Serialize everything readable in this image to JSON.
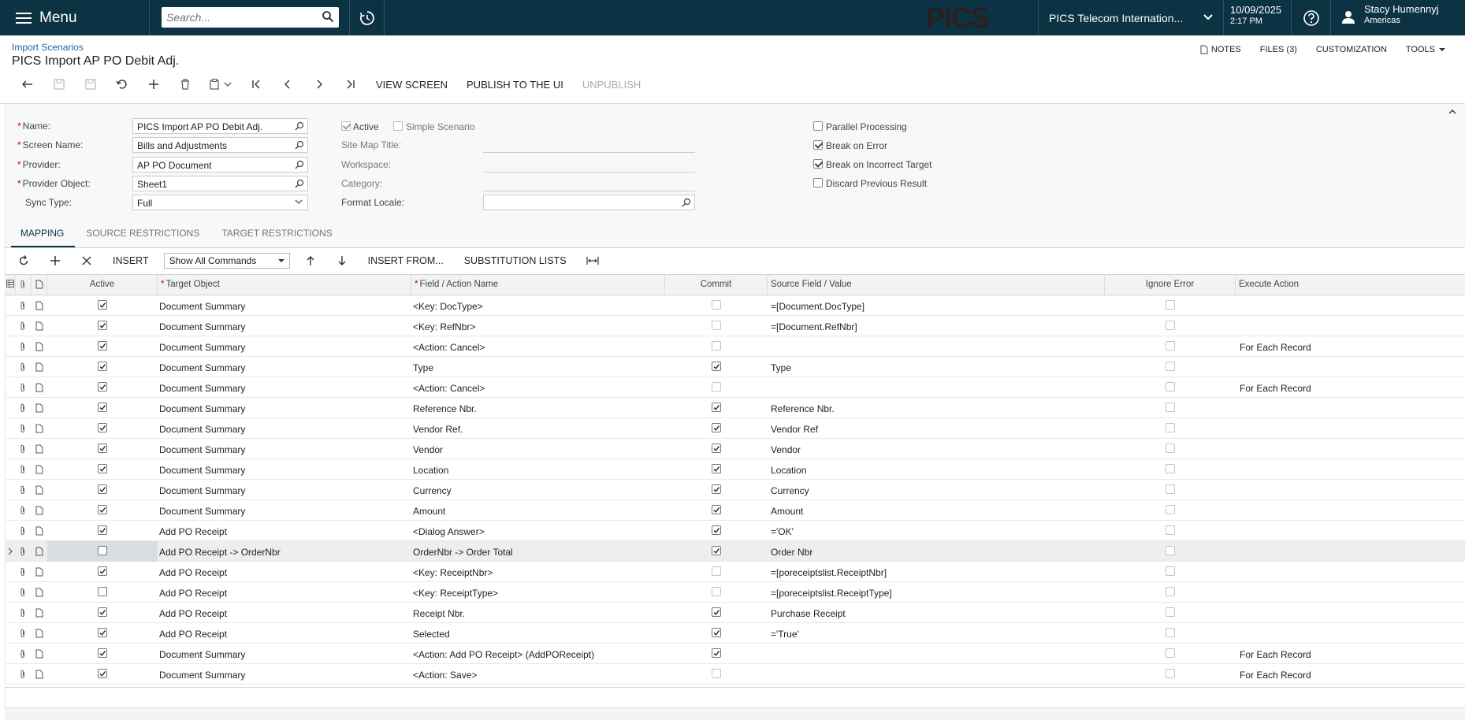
{
  "topbar": {
    "menu_label": "Menu",
    "search_placeholder": "Search...",
    "logo": "PICS",
    "company": "PICS Telecom Internation...",
    "date": "10/09/2025",
    "time": "2:17 PM",
    "user_name": "Stacy Humennyj",
    "user_region": "Americas"
  },
  "header": {
    "breadcrumb": "Import Scenarios",
    "title": "PICS Import AP PO Debit Adj.",
    "links": {
      "notes": "NOTES",
      "files": "FILES (3)",
      "customization": "CUSTOMIZATION",
      "tools": "TOOLS"
    }
  },
  "toolbar": {
    "view_screen": "VIEW SCREEN",
    "publish": "PUBLISH TO THE UI",
    "unpublish": "UNPUBLISH"
  },
  "form": {
    "name_label": "Name:",
    "name_value": "PICS Import AP PO Debit Adj.",
    "screen_label": "Screen Name:",
    "screen_value": "Bills and Adjustments",
    "provider_label": "Provider:",
    "provider_value": "AP PO Document",
    "provider_object_label": "Provider Object:",
    "provider_object_value": "Sheet1",
    "sync_label": "Sync Type:",
    "sync_value": "Full",
    "active_label": "Active",
    "simple_label": "Simple Scenario",
    "sitemap_label": "Site Map Title:",
    "workspace_label": "Workspace:",
    "category_label": "Category:",
    "locale_label": "Format Locale:",
    "parallel_label": "Parallel Processing",
    "break_error_label": "Break on Error",
    "break_target_label": "Break on Incorrect Target",
    "discard_label": "Discard Previous Result",
    "active_checked": true,
    "simple_checked": false,
    "parallel_checked": false,
    "break_error_checked": true,
    "break_target_checked": true,
    "discard_checked": false
  },
  "tabs": [
    "MAPPING",
    "SOURCE RESTRICTIONS",
    "TARGET RESTRICTIONS"
  ],
  "grid_toolbar": {
    "insert": "INSERT",
    "show_commands": "Show All Commands",
    "insert_from": "INSERT FROM...",
    "substitution": "SUBSTITUTION LISTS"
  },
  "columns": {
    "active": "Active",
    "target": "Target Object",
    "field": "Field / Action Name",
    "commit": "Commit",
    "source": "Source Field / Value",
    "ignore": "Ignore Error",
    "execute": "Execute Action"
  },
  "rows": [
    {
      "active": true,
      "target": "Document Summary",
      "field": "<Key: DocType>",
      "commit": false,
      "commit_dim": true,
      "source": "=[Document.DocType]",
      "ignore": false,
      "execute": ""
    },
    {
      "active": true,
      "target": "Document Summary",
      "field": "<Key: RefNbr>",
      "commit": false,
      "commit_dim": true,
      "source": "=[Document.RefNbr]",
      "ignore": false,
      "execute": ""
    },
    {
      "active": true,
      "target": "Document Summary",
      "field": "<Action: Cancel>",
      "commit": false,
      "commit_dim": true,
      "source": "",
      "ignore": false,
      "execute": "For Each Record"
    },
    {
      "active": true,
      "target": "Document Summary",
      "field": "Type",
      "commit": true,
      "commit_dim": false,
      "source": "Type",
      "ignore": false,
      "execute": ""
    },
    {
      "active": true,
      "target": "Document Summary",
      "field": "<Action: Cancel>",
      "commit": false,
      "commit_dim": true,
      "source": "",
      "ignore": false,
      "execute": "For Each Record"
    },
    {
      "active": true,
      "target": "Document Summary",
      "field": "Reference Nbr.",
      "commit": true,
      "commit_dim": false,
      "source": "Reference Nbr.",
      "ignore": false,
      "execute": ""
    },
    {
      "active": true,
      "target": "Document Summary",
      "field": "Vendor Ref.",
      "commit": true,
      "commit_dim": false,
      "source": "Vendor Ref",
      "ignore": false,
      "execute": ""
    },
    {
      "active": true,
      "target": "Document Summary",
      "field": "Vendor",
      "commit": true,
      "commit_dim": false,
      "source": "Vendor",
      "ignore": false,
      "execute": ""
    },
    {
      "active": true,
      "target": "Document Summary",
      "field": "Location",
      "commit": true,
      "commit_dim": false,
      "source": "Location",
      "ignore": false,
      "execute": ""
    },
    {
      "active": true,
      "target": "Document Summary",
      "field": "Currency",
      "commit": true,
      "commit_dim": false,
      "source": "Currency",
      "ignore": false,
      "execute": ""
    },
    {
      "active": true,
      "target": "Document Summary",
      "field": "Amount",
      "commit": true,
      "commit_dim": false,
      "source": "Amount",
      "ignore": false,
      "execute": ""
    },
    {
      "active": true,
      "target": "Add PO Receipt",
      "field": "<Dialog Answer>",
      "commit": true,
      "commit_dim": false,
      "source": "='OK'",
      "ignore": false,
      "execute": ""
    },
    {
      "active": false,
      "target": "Add PO Receipt -> OrderNbr",
      "field": "OrderNbr -> Order Total",
      "commit": true,
      "commit_dim": false,
      "source": "Order Nbr",
      "ignore": false,
      "execute": "",
      "selected": true
    },
    {
      "active": true,
      "target": "Add PO Receipt",
      "field": "<Key: ReceiptNbr>",
      "commit": false,
      "commit_dim": true,
      "source": "=[poreceiptslist.ReceiptNbr]",
      "ignore": false,
      "execute": ""
    },
    {
      "active": false,
      "target": "Add PO Receipt",
      "field": "<Key: ReceiptType>",
      "commit": false,
      "commit_dim": true,
      "source": "=[poreceiptslist.ReceiptType]",
      "ignore": false,
      "execute": ""
    },
    {
      "active": true,
      "target": "Add PO Receipt",
      "field": "Receipt Nbr.",
      "commit": true,
      "commit_dim": false,
      "source": "Purchase Receipt",
      "ignore": false,
      "execute": ""
    },
    {
      "active": true,
      "target": "Add PO Receipt",
      "field": "Selected",
      "commit": true,
      "commit_dim": false,
      "source": "='True'",
      "ignore": false,
      "execute": ""
    },
    {
      "active": true,
      "target": "Document Summary",
      "field": "<Action: Add PO Receipt> (AddPOReceipt)",
      "commit": true,
      "commit_dim": false,
      "source": "",
      "ignore": false,
      "execute": "For Each Record"
    },
    {
      "active": true,
      "target": "Document Summary",
      "field": "<Action: Save>",
      "commit": false,
      "commit_dim": true,
      "source": "",
      "ignore": false,
      "execute": "For Each Record"
    }
  ]
}
